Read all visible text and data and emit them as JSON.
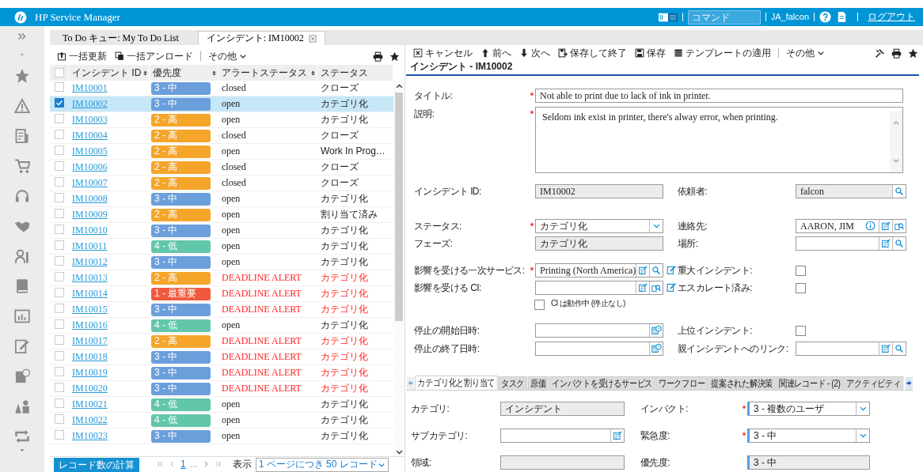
{
  "header": {
    "title": "HP Service Manager",
    "command_placeholder": "コマンド",
    "user": "JA_falcon",
    "logout": "ログアウト"
  },
  "main_tabs": [
    {
      "label": "To Do キュー: My To Do List",
      "selected": false
    },
    {
      "label": "インシデント: IM10002",
      "selected": true
    }
  ],
  "list": {
    "toolbar": [
      {
        "label": "一括更新",
        "kind": "update"
      },
      {
        "label": "一括アンロード",
        "kind": "unload"
      },
      {
        "label": "その他",
        "kind": "more"
      }
    ],
    "all_checked": false,
    "columns": [
      "インシデント ID",
      "優先度",
      "アラートステータス",
      "ステータス"
    ],
    "rows": [
      {
        "id": "IM10001",
        "priority": "3 - 中",
        "color": "#6a9fdc",
        "alert_status": "closed",
        "status": "クローズ",
        "alert": false,
        "selected": false,
        "checked": false
      },
      {
        "id": "IM10002",
        "priority": "3 - 中",
        "color": "#6a9fdc",
        "alert_status": "open",
        "status": "カテゴリ化",
        "alert": false,
        "selected": true,
        "checked": true
      },
      {
        "id": "IM10003",
        "priority": "2 - 高",
        "color": "#f5a52a",
        "alert_status": "open",
        "status": "カテゴリ化",
        "alert": false,
        "selected": false,
        "checked": false
      },
      {
        "id": "IM10004",
        "priority": "2 - 高",
        "color": "#f5a52a",
        "alert_status": "closed",
        "status": "クローズ",
        "alert": false,
        "selected": false,
        "checked": false
      },
      {
        "id": "IM10005",
        "priority": "2 - 高",
        "color": "#f5a52a",
        "alert_status": "open",
        "status": "Work In Prog…",
        "alert": false,
        "selected": false,
        "checked": false
      },
      {
        "id": "IM10006",
        "priority": "2 - 高",
        "color": "#f5a52a",
        "alert_status": "closed",
        "status": "クローズ",
        "alert": false,
        "selected": false,
        "checked": false
      },
      {
        "id": "IM10007",
        "priority": "2 - 高",
        "color": "#f5a52a",
        "alert_status": "closed",
        "status": "クローズ",
        "alert": false,
        "selected": false,
        "checked": false
      },
      {
        "id": "IM10008",
        "priority": "3 - 中",
        "color": "#6a9fdc",
        "alert_status": "open",
        "status": "カテゴリ化",
        "alert": false,
        "selected": false,
        "checked": false
      },
      {
        "id": "IM10009",
        "priority": "2 - 高",
        "color": "#f5a52a",
        "alert_status": "open",
        "status": "割り当て済み",
        "alert": false,
        "selected": false,
        "checked": false
      },
      {
        "id": "IM10010",
        "priority": "3 - 中",
        "color": "#6a9fdc",
        "alert_status": "open",
        "status": "カテゴリ化",
        "alert": false,
        "selected": false,
        "checked": false
      },
      {
        "id": "IM10011",
        "priority": "4 - 低",
        "color": "#62c6ab",
        "alert_status": "open",
        "status": "カテゴリ化",
        "alert": false,
        "selected": false,
        "checked": false
      },
      {
        "id": "IM10012",
        "priority": "3 - 中",
        "color": "#6a9fdc",
        "alert_status": "open",
        "status": "カテゴリ化",
        "alert": false,
        "selected": false,
        "checked": false
      },
      {
        "id": "IM10013",
        "priority": "2 - 高",
        "color": "#f5a52a",
        "alert_status": "DEADLINE ALERT",
        "status": "カテゴリ化",
        "alert": true,
        "selected": false,
        "checked": false
      },
      {
        "id": "IM10014",
        "priority": "1 - 最重要",
        "color": "#ef5a3f",
        "alert_status": "DEADLINE ALERT",
        "status": "カテゴリ化",
        "alert": true,
        "selected": false,
        "checked": false
      },
      {
        "id": "IM10015",
        "priority": "3 - 中",
        "color": "#6a9fdc",
        "alert_status": "DEADLINE ALERT",
        "status": "カテゴリ化",
        "alert": true,
        "selected": false,
        "checked": false
      },
      {
        "id": "IM10016",
        "priority": "4 - 低",
        "color": "#62c6ab",
        "alert_status": "open",
        "status": "カテゴリ化",
        "alert": false,
        "selected": false,
        "checked": false
      },
      {
        "id": "IM10017",
        "priority": "2 - 高",
        "color": "#f5a52a",
        "alert_status": "DEADLINE ALERT",
        "status": "カテゴリ化",
        "alert": true,
        "selected": false,
        "checked": false
      },
      {
        "id": "IM10018",
        "priority": "3 - 中",
        "color": "#6a9fdc",
        "alert_status": "DEADLINE ALERT",
        "status": "カテゴリ化",
        "alert": true,
        "selected": false,
        "checked": false
      },
      {
        "id": "IM10019",
        "priority": "3 - 中",
        "color": "#6a9fdc",
        "alert_status": "DEADLINE ALERT",
        "status": "カテゴリ化",
        "alert": true,
        "selected": false,
        "checked": false
      },
      {
        "id": "IM10020",
        "priority": "3 - 中",
        "color": "#6a9fdc",
        "alert_status": "DEADLINE ALERT",
        "status": "カテゴリ化",
        "alert": true,
        "selected": false,
        "checked": false
      },
      {
        "id": "IM10021",
        "priority": "4 - 低",
        "color": "#62c6ab",
        "alert_status": "open",
        "status": "カテゴリ化",
        "alert": false,
        "selected": false,
        "checked": false
      },
      {
        "id": "IM10022",
        "priority": "4 - 低",
        "color": "#62c6ab",
        "alert_status": "open",
        "status": "カテゴリ化",
        "alert": false,
        "selected": false,
        "checked": false
      },
      {
        "id": "IM10023",
        "priority": "3 - 中",
        "color": "#6a9fdc",
        "alert_status": "open",
        "status": "カテゴリ化",
        "alert": false,
        "selected": false,
        "checked": false
      }
    ],
    "count_button": "レコード数の計算",
    "page": "1",
    "ellipsis": "...",
    "display_label": "表示",
    "page_size": "1 ページにつき 50 レコード"
  },
  "detail": {
    "toolbar": [
      {
        "label": "キャンセル",
        "kind": "cancel"
      },
      {
        "label": "前へ",
        "kind": "up"
      },
      {
        "label": "次へ",
        "kind": "down"
      },
      {
        "label": "保存して終了",
        "kind": "save-exit"
      },
      {
        "label": "保存",
        "kind": "save"
      },
      {
        "label": "テンプレートの適用",
        "kind": "template"
      },
      {
        "label": "その他",
        "kind": "more"
      }
    ],
    "title": "インシデント - IM10002",
    "form": [
      {
        "left": {
          "label": "タイトル:",
          "required": true,
          "kind": "text",
          "value": "Not able to print due to lack of ink in printer."
        }
      },
      {
        "left": {
          "label": "説明:",
          "required": true,
          "kind": "textarea",
          "value": "Seldom ink exist in printer, there's alway error, when printing."
        }
      },
      {
        "left": {
          "label": "インシデント ID:",
          "required": false,
          "kind": "readonly",
          "value": "IM10002"
        },
        "right": {
          "label": "依頼者:",
          "required": false,
          "kind": "search-lookup",
          "readonly": true,
          "value": "falcon"
        }
      },
      {
        "left": {
          "label": "ステータス:",
          "required": true,
          "kind": "select",
          "value": "カテゴリ化"
        },
        "right": {
          "label": "連絡先:",
          "required": false,
          "kind": "contact",
          "readonly": false,
          "value": "AARON, JIM"
        }
      },
      {
        "left": {
          "label": "フェーズ:",
          "required": false,
          "kind": "readonly",
          "value": "カテゴリ化"
        },
        "right": {
          "label": "場所:",
          "required": false,
          "kind": "lookup",
          "readonly": false
        }
      },
      {
        "left": {
          "label": "影響を受ける一次サービス:",
          "required": true,
          "kind": "service",
          "readonly": false,
          "value": "Printing (North America)"
        },
        "right": {
          "label": "重大インシデント:",
          "required": false,
          "kind": "checkbox",
          "checked": false
        }
      },
      {
        "left": {
          "label": "影響を受ける CI:",
          "required": false,
          "kind": "ci",
          "readonly": false
        },
        "right": {
          "label": "エスカレート済み:",
          "required": false,
          "kind": "checkbox",
          "checked": false
        }
      },
      {
        "left": {
          "label": "CI は動作中 (停止なし)",
          "kind": "check-label",
          "checked": false
        }
      },
      {
        "left": {
          "label": "停止の開始日時:",
          "required": false,
          "kind": "datetime"
        },
        "right": {
          "label": "上位インシデント:",
          "required": false,
          "kind": "checkbox",
          "checked": false
        }
      },
      {
        "left": {
          "label": "停止の終了日時:",
          "required": false,
          "kind": "datetime"
        },
        "right": {
          "label": "親インシデントへのリンク:",
          "required": false,
          "kind": "lookup",
          "readonly": false
        }
      }
    ],
    "tabs": [
      {
        "label": "カテゴリ化と割り当て",
        "selected": true
      },
      {
        "label": "タスク",
        "selected": false
      },
      {
        "label": "原価",
        "selected": false
      },
      {
        "label": "インパクトを受けるサービス",
        "selected": false
      },
      {
        "label": "ワークフロー",
        "selected": false
      },
      {
        "label": "提案された解決策",
        "selected": false
      },
      {
        "label": "関連レコード - (2)",
        "selected": false
      },
      {
        "label": "アクティビティ",
        "selected": false
      }
    ],
    "tab_form": [
      {
        "left": {
          "label": "カテゴリ:",
          "required": false,
          "kind": "readonly",
          "value": "インシデント"
        },
        "right": {
          "label": "インパクト:",
          "required": true,
          "kind": "select",
          "value": "3 - 複数のユーザ"
        }
      },
      {
        "left": {
          "label": "サブカテゴリ:",
          "required": false,
          "kind": "fill-lookup",
          "readonly": false
        },
        "right": {
          "label": "緊急度:",
          "required": true,
          "kind": "select",
          "value": "3 - 中"
        }
      },
      {
        "left": {
          "label": "領域:",
          "required": false,
          "kind": "readonly"
        },
        "right": {
          "label": "優先度:",
          "required": false,
          "kind": "readonly",
          "value": "3 - 中"
        }
      }
    ]
  }
}
